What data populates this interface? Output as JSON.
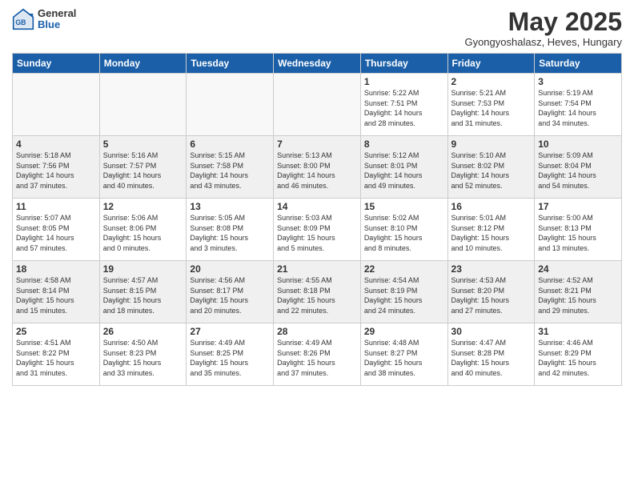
{
  "header": {
    "logo_general": "General",
    "logo_blue": "Blue",
    "title": "May 2025",
    "location": "Gyongyoshalasz, Heves, Hungary"
  },
  "days_of_week": [
    "Sunday",
    "Monday",
    "Tuesday",
    "Wednesday",
    "Thursday",
    "Friday",
    "Saturday"
  ],
  "weeks": [
    [
      {
        "day": "",
        "info": ""
      },
      {
        "day": "",
        "info": ""
      },
      {
        "day": "",
        "info": ""
      },
      {
        "day": "",
        "info": ""
      },
      {
        "day": "1",
        "info": "Sunrise: 5:22 AM\nSunset: 7:51 PM\nDaylight: 14 hours\nand 28 minutes."
      },
      {
        "day": "2",
        "info": "Sunrise: 5:21 AM\nSunset: 7:53 PM\nDaylight: 14 hours\nand 31 minutes."
      },
      {
        "day": "3",
        "info": "Sunrise: 5:19 AM\nSunset: 7:54 PM\nDaylight: 14 hours\nand 34 minutes."
      }
    ],
    [
      {
        "day": "4",
        "info": "Sunrise: 5:18 AM\nSunset: 7:56 PM\nDaylight: 14 hours\nand 37 minutes."
      },
      {
        "day": "5",
        "info": "Sunrise: 5:16 AM\nSunset: 7:57 PM\nDaylight: 14 hours\nand 40 minutes."
      },
      {
        "day": "6",
        "info": "Sunrise: 5:15 AM\nSunset: 7:58 PM\nDaylight: 14 hours\nand 43 minutes."
      },
      {
        "day": "7",
        "info": "Sunrise: 5:13 AM\nSunset: 8:00 PM\nDaylight: 14 hours\nand 46 minutes."
      },
      {
        "day": "8",
        "info": "Sunrise: 5:12 AM\nSunset: 8:01 PM\nDaylight: 14 hours\nand 49 minutes."
      },
      {
        "day": "9",
        "info": "Sunrise: 5:10 AM\nSunset: 8:02 PM\nDaylight: 14 hours\nand 52 minutes."
      },
      {
        "day": "10",
        "info": "Sunrise: 5:09 AM\nSunset: 8:04 PM\nDaylight: 14 hours\nand 54 minutes."
      }
    ],
    [
      {
        "day": "11",
        "info": "Sunrise: 5:07 AM\nSunset: 8:05 PM\nDaylight: 14 hours\nand 57 minutes."
      },
      {
        "day": "12",
        "info": "Sunrise: 5:06 AM\nSunset: 8:06 PM\nDaylight: 15 hours\nand 0 minutes."
      },
      {
        "day": "13",
        "info": "Sunrise: 5:05 AM\nSunset: 8:08 PM\nDaylight: 15 hours\nand 3 minutes."
      },
      {
        "day": "14",
        "info": "Sunrise: 5:03 AM\nSunset: 8:09 PM\nDaylight: 15 hours\nand 5 minutes."
      },
      {
        "day": "15",
        "info": "Sunrise: 5:02 AM\nSunset: 8:10 PM\nDaylight: 15 hours\nand 8 minutes."
      },
      {
        "day": "16",
        "info": "Sunrise: 5:01 AM\nSunset: 8:12 PM\nDaylight: 15 hours\nand 10 minutes."
      },
      {
        "day": "17",
        "info": "Sunrise: 5:00 AM\nSunset: 8:13 PM\nDaylight: 15 hours\nand 13 minutes."
      }
    ],
    [
      {
        "day": "18",
        "info": "Sunrise: 4:58 AM\nSunset: 8:14 PM\nDaylight: 15 hours\nand 15 minutes."
      },
      {
        "day": "19",
        "info": "Sunrise: 4:57 AM\nSunset: 8:15 PM\nDaylight: 15 hours\nand 18 minutes."
      },
      {
        "day": "20",
        "info": "Sunrise: 4:56 AM\nSunset: 8:17 PM\nDaylight: 15 hours\nand 20 minutes."
      },
      {
        "day": "21",
        "info": "Sunrise: 4:55 AM\nSunset: 8:18 PM\nDaylight: 15 hours\nand 22 minutes."
      },
      {
        "day": "22",
        "info": "Sunrise: 4:54 AM\nSunset: 8:19 PM\nDaylight: 15 hours\nand 24 minutes."
      },
      {
        "day": "23",
        "info": "Sunrise: 4:53 AM\nSunset: 8:20 PM\nDaylight: 15 hours\nand 27 minutes."
      },
      {
        "day": "24",
        "info": "Sunrise: 4:52 AM\nSunset: 8:21 PM\nDaylight: 15 hours\nand 29 minutes."
      }
    ],
    [
      {
        "day": "25",
        "info": "Sunrise: 4:51 AM\nSunset: 8:22 PM\nDaylight: 15 hours\nand 31 minutes."
      },
      {
        "day": "26",
        "info": "Sunrise: 4:50 AM\nSunset: 8:23 PM\nDaylight: 15 hours\nand 33 minutes."
      },
      {
        "day": "27",
        "info": "Sunrise: 4:49 AM\nSunset: 8:25 PM\nDaylight: 15 hours\nand 35 minutes."
      },
      {
        "day": "28",
        "info": "Sunrise: 4:49 AM\nSunset: 8:26 PM\nDaylight: 15 hours\nand 37 minutes."
      },
      {
        "day": "29",
        "info": "Sunrise: 4:48 AM\nSunset: 8:27 PM\nDaylight: 15 hours\nand 38 minutes."
      },
      {
        "day": "30",
        "info": "Sunrise: 4:47 AM\nSunset: 8:28 PM\nDaylight: 15 hours\nand 40 minutes."
      },
      {
        "day": "31",
        "info": "Sunrise: 4:46 AM\nSunset: 8:29 PM\nDaylight: 15 hours\nand 42 minutes."
      }
    ]
  ]
}
